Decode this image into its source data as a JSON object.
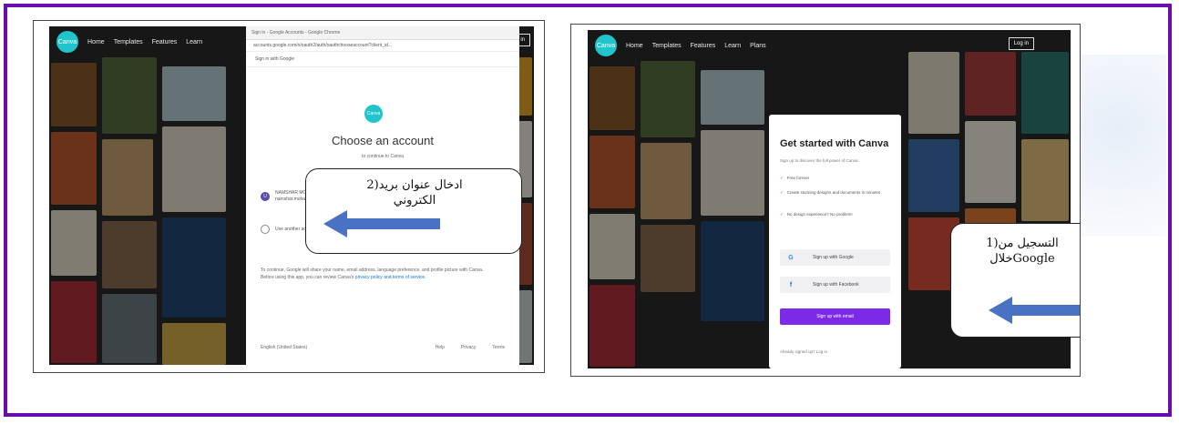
{
  "colors": {
    "frame": "#6a0dad",
    "canva_teal": "#20c4cb",
    "canva_purple": "#7d2ae8",
    "arrow": "#4a72c4"
  },
  "left_shot": {
    "nav": {
      "logo": "Canva",
      "items": [
        "Home",
        "Templates",
        "Features",
        "Learn"
      ],
      "login": "Log in"
    },
    "popup": {
      "window_title": "Sign in - Google Accounts - Google Chrome",
      "url": "accounts.google.com/o/oauth2/auth/oauthchooseaccount?client_id...",
      "subheader": "Sign in with Google",
      "logo": "Canva",
      "title": "Choose an account",
      "continue_to": "to continue to Canva",
      "account_initial": "U",
      "account_name": "NAMSHAR MOHAMMED",
      "account_email": "namshar.mohammed@gmail.com",
      "use_another": "Use another account",
      "consent": "To continue, Google will share your name, email address, language preference, and profile picture with Canva. Before using this app, you can review Canva's",
      "consent_links": "privacy policy and terms of service.",
      "language": "English (United States)",
      "footer_links": [
        "Help",
        "Privacy",
        "Terms"
      ]
    },
    "callout": {
      "line1": "2)ادخال عنوان بريد",
      "line2": "الكتروني"
    }
  },
  "right_shot": {
    "nav": {
      "logo": "Canva",
      "items": [
        "Home",
        "Templates",
        "Features",
        "Learn",
        "Plans"
      ],
      "login": "Log in"
    },
    "modal": {
      "title": "Get started with Canva",
      "subtitle": "Sign up to discover the full power of Canva.",
      "bullets": [
        "Free forever",
        "Create stunning designs and documents in minutes",
        "No design experience? No problem!"
      ],
      "google_btn": "Sign up with Google",
      "facebook_btn": "Sign up with Facebook",
      "email_btn": "Sign up with email",
      "footer": "Already signed up? Log in"
    },
    "callout": {
      "line1": "1)التسجيل من",
      "line2": "خلالGoogle"
    }
  }
}
